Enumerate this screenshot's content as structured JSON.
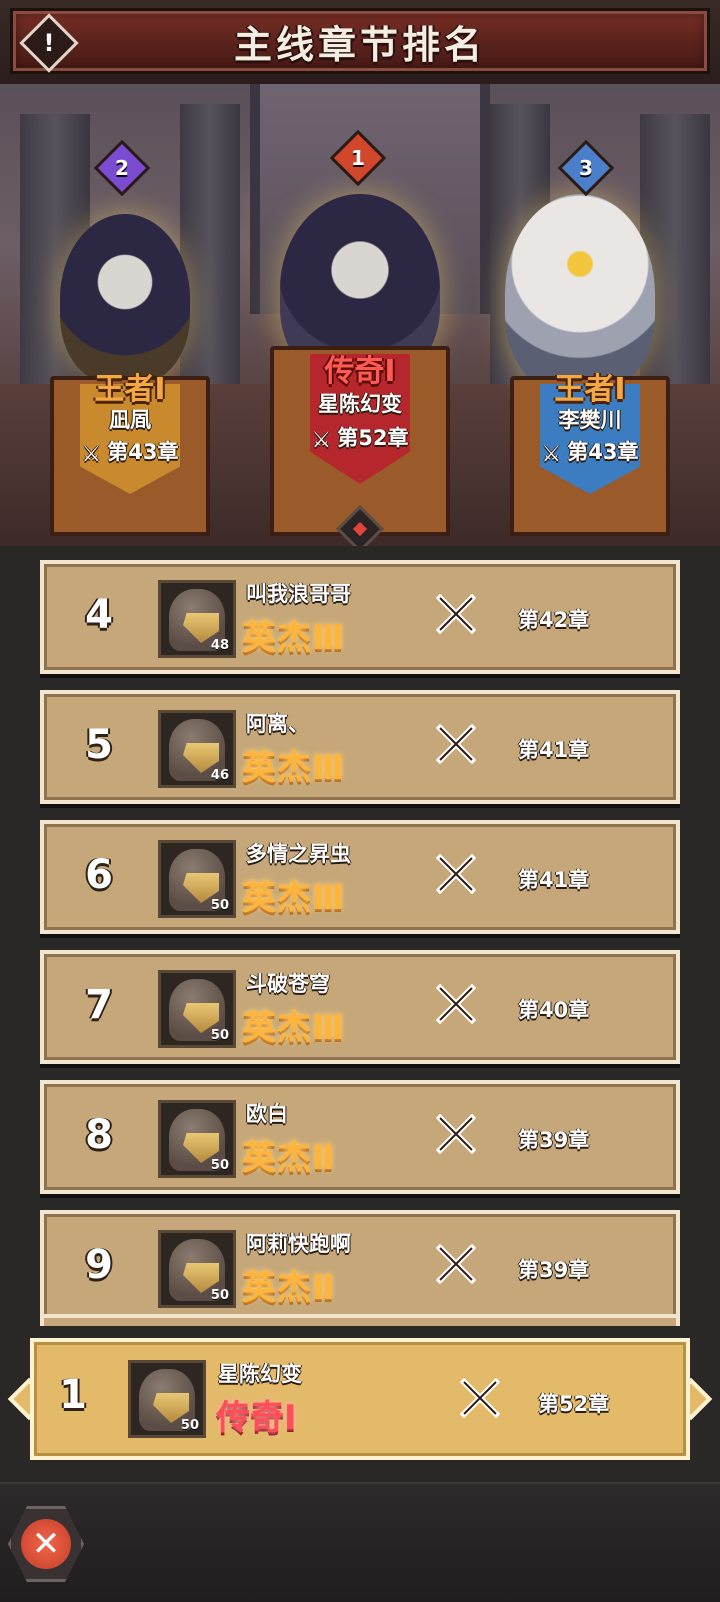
{
  "header": {
    "title": "主线章节排名",
    "info_icon": "exclamation-icon"
  },
  "podium": [
    {
      "rank": "2",
      "tier": "王者I",
      "name": "凪凮",
      "chapter": "第43章",
      "badge_color": "#7b4bd1",
      "banner_color": "#c98a2d"
    },
    {
      "rank": "1",
      "tier": "传奇I",
      "name": "星陈幻变",
      "chapter": "第52章",
      "badge_color": "#d1472c",
      "banner_color": "#b5262d"
    },
    {
      "rank": "3",
      "tier": "王者I",
      "name": "李樊川",
      "chapter": "第43章",
      "badge_color": "#4b7fc9",
      "banner_color": "#3c7cc1"
    }
  ],
  "rows": [
    {
      "rank": "4",
      "name": "叫我浪哥哥",
      "tier": "英杰Ⅲ",
      "level": "48",
      "chapter": "第42章"
    },
    {
      "rank": "5",
      "name": "阿离、",
      "tier": "英杰Ⅲ",
      "level": "46",
      "chapter": "第41章"
    },
    {
      "rank": "6",
      "name": "多情之昇虫",
      "tier": "英杰Ⅲ",
      "level": "50",
      "chapter": "第41章"
    },
    {
      "rank": "7",
      "name": "斗破苍穹",
      "tier": "英杰Ⅲ",
      "level": "50",
      "chapter": "第40章"
    },
    {
      "rank": "8",
      "name": "欧白",
      "tier": "英杰Ⅱ",
      "level": "50",
      "chapter": "第39章"
    },
    {
      "rank": "9",
      "name": "阿莉快跑啊",
      "tier": "英杰Ⅱ",
      "level": "50",
      "chapter": "第39章"
    }
  ],
  "my_rank": {
    "rank": "1",
    "name": "星陈幻变",
    "tier": "传奇I",
    "level": "50",
    "chapter": "第52章"
  },
  "footer": {
    "close_icon": "close-icon"
  },
  "colors": {
    "row_bg": "#c6a779",
    "my_bar_bg": "#e3ba6a",
    "tier_gold": "#ffb43b",
    "tier_legend": "#ff4e58"
  }
}
